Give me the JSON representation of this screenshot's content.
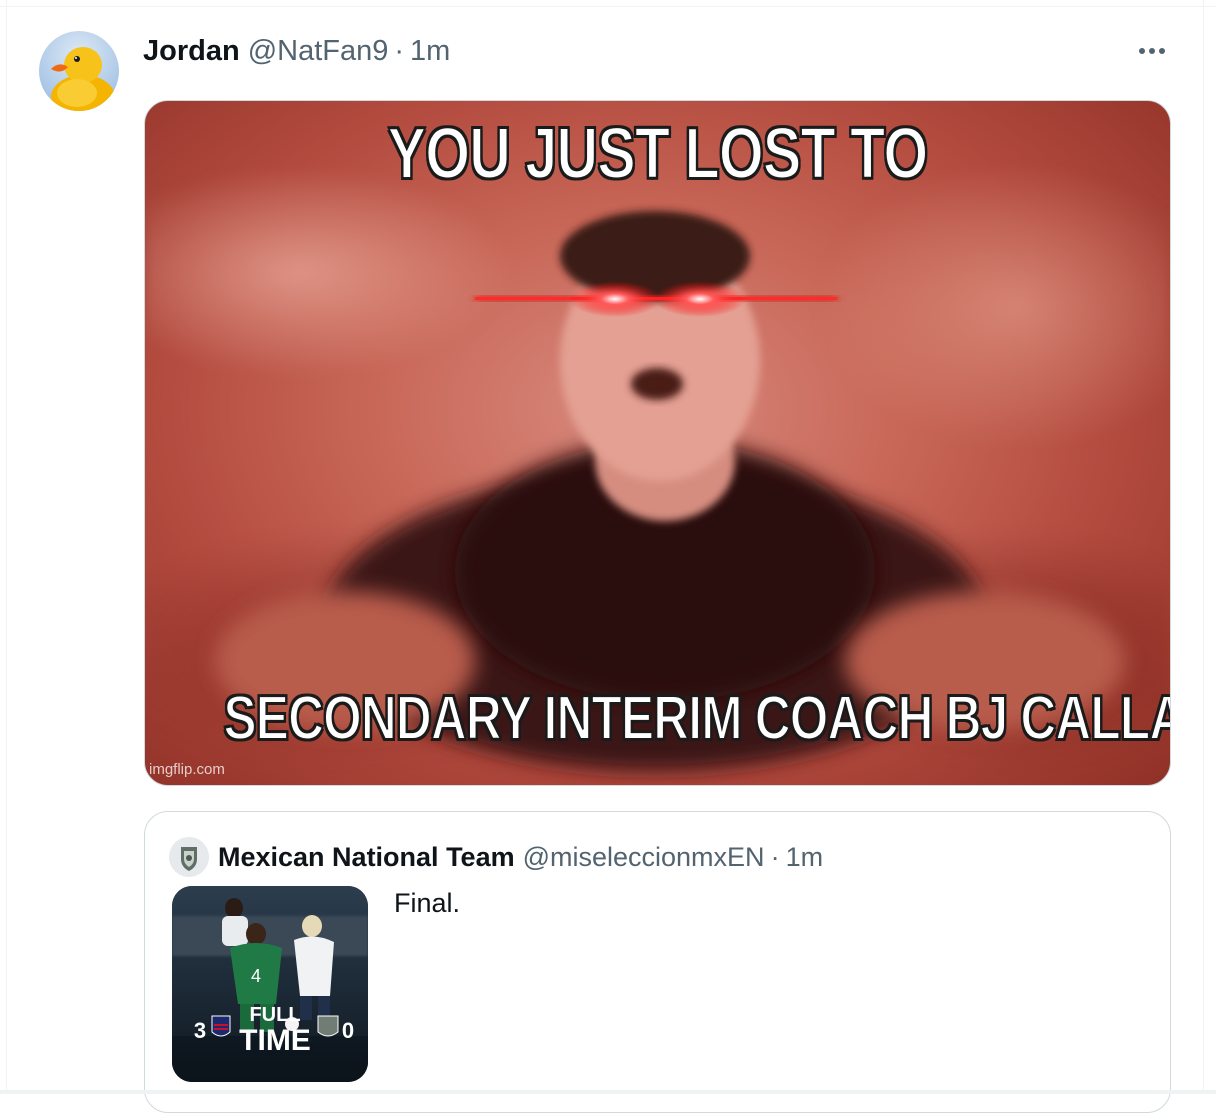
{
  "tweet": {
    "author_name": "Jordan",
    "author_handle": "@NatFan9",
    "separator": "·",
    "time": "1m",
    "avatar_icon": "rubber-duck-icon",
    "more_icon": "more-horizontal-icon",
    "meme": {
      "top_text": "YOU JUST LOST TO",
      "bottom_text": "SECONDARY INTERIM COACH BJ CALLAGHAN",
      "watermark": "imgflip.com"
    }
  },
  "quoted_tweet": {
    "author_name": "Mexican National Team",
    "author_handle": "@miseleccionmxEN",
    "separator": "·",
    "time": "1m",
    "avatar_icon": "mexico-crest-icon",
    "text": "Final.",
    "thumbnail": {
      "headline_line1": "FULL",
      "headline_line2": "TIME",
      "home_score": "3",
      "away_score": "0",
      "player_number": "4"
    }
  },
  "colors": {
    "text_primary": "#0f1419",
    "text_secondary": "#536471",
    "border": "#cfd9de"
  }
}
